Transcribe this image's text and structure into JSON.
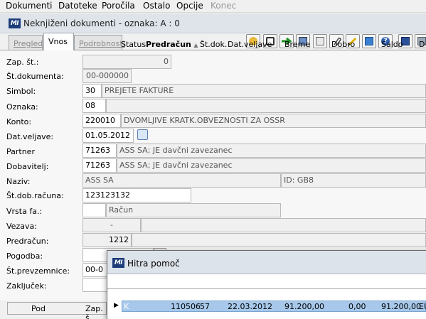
{
  "menubar": {
    "items": [
      "Dokumenti",
      "Datoteke",
      "Poročila",
      "Ostalo",
      "Opcije",
      "Konec"
    ]
  },
  "window": {
    "logo": "MI",
    "title": "Neknjiženi dokumenti  - oznaka: A : 0"
  },
  "tabs": [
    "Pregled",
    "Vnos",
    "Podrobnosti"
  ],
  "toolbar": {
    "icons": [
      "people-icon",
      "refresh-icon",
      "arrow-right-icon",
      "book-icon",
      "list-icon",
      "paperclip-icon",
      "pencil-icon",
      "monitor-icon",
      "help-icon",
      "save-icon",
      "folder-icon"
    ]
  },
  "form": {
    "labels": {
      "zap_st": "Zap. št.:",
      "st_dokumenta": "Št.dokumenta:",
      "simbol": "Simbol:",
      "oznaka": "Oznaka:",
      "konto": "Konto:",
      "dat_veljave": "Dat.veljave:",
      "partner": "Partner",
      "dobavitelj": "Dobavitelj:",
      "naziv": "Naziv:",
      "st_dob_racuna": "Št.dob.računa:",
      "vrsta_fa": "Vrsta fa.:",
      "vezava": "Vezava:",
      "predracun": "Predračun:",
      "pogodba": "Pogodba:",
      "st_prevzemnice": "Št.prevzemnice:",
      "zakljucek": "Zaključek:"
    },
    "values": {
      "zap_st": "0",
      "st_dokumenta": "00-000000",
      "simbol_code": "30",
      "simbol_text": "PREJETE FAKTURE",
      "oznaka": "08",
      "konto_code": "220010",
      "konto_text": "DVOMLJIVE KRATK.OBVEZNOSTI ZA OSSR",
      "dat_veljave": "01.05.2012",
      "partner_code": "71263",
      "partner_text": "ASS SA; JE davčni zavezanec",
      "dobavitelj_code": "71263",
      "dobavitelj_text": "ASS SA; JE davčni zavezanec",
      "naziv": "ASS SA",
      "naziv_id": "ID: GB8",
      "st_dob_racuna": "123123132",
      "vrsta_fa_text": "Račun",
      "vezava": "-",
      "predracun": "1212",
      "st_prevzemnice": "00-0"
    }
  },
  "bottom": {
    "col_pod": "Pod",
    "col_zap": "Zap. š"
  },
  "help_popup": {
    "title": "Hitra pomoč",
    "columns": [
      "Status",
      "Predračun",
      "Št.dok.",
      "Dat.veljave",
      "Breme",
      "Dobro",
      "Saldo",
      "D"
    ],
    "row": {
      "status": "K",
      "predracun": "110506",
      "st_dok": "57",
      "dat_veljave": "22.03.2012",
      "breme": "91.200,00",
      "dobro": "0,00",
      "saldo": "91.200,00",
      "d": "EU"
    }
  }
}
